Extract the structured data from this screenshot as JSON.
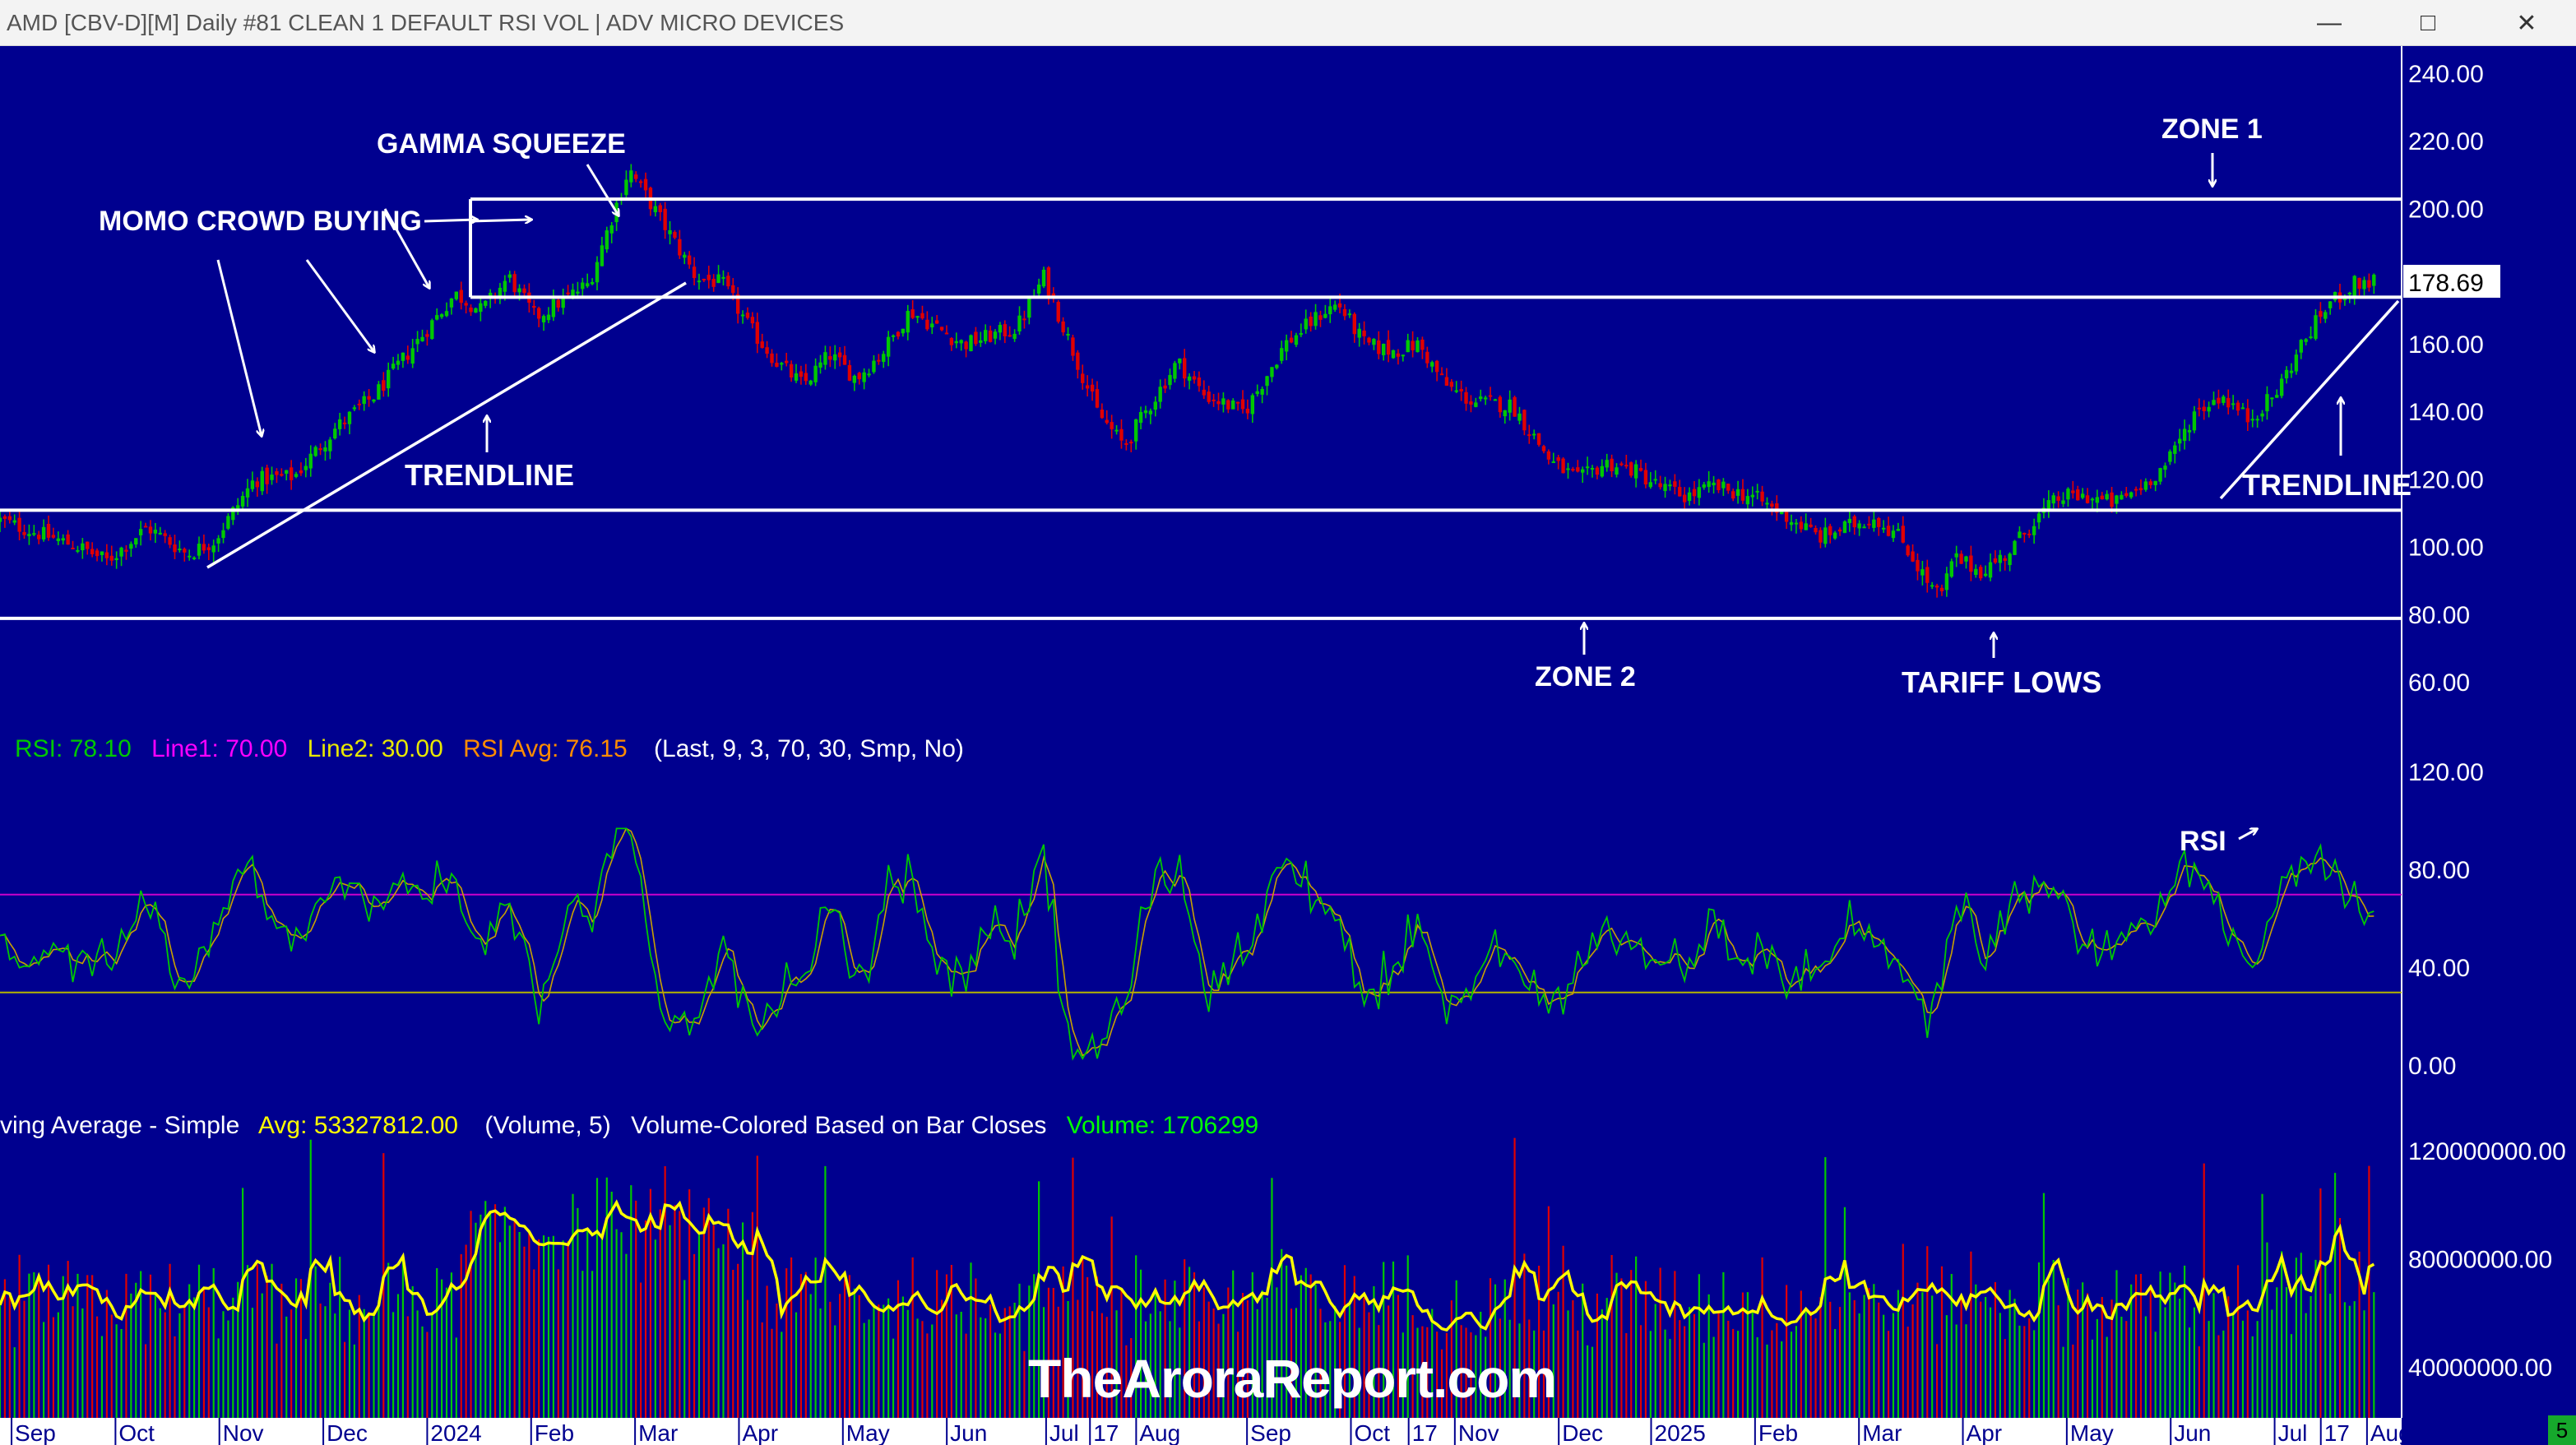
{
  "window": {
    "title": "AMD [CBV-D][M]  Daily #81 CLEAN  1 DEFAULT RSI VOL | ADV MICRO DEVICES",
    "minimize_icon": "minimize-icon",
    "maximize_icon": "maximize-icon",
    "close_icon": "close-icon"
  },
  "watermark": "TheAroraReport.com",
  "badge": "5",
  "chart_data": [
    {
      "type": "candlestick",
      "ylim": [
        55,
        245
      ],
      "y_ticks": [
        "240.00",
        "220.00",
        "200.00",
        "180.00",
        "160.00",
        "140.00",
        "120.00",
        "100.00",
        "80.00",
        "60.00"
      ],
      "last_price": "178.69",
      "up_color": "#00c800",
      "down_color": "#e00000",
      "close_path": [
        {
          "t": 0,
          "v": 108
        },
        {
          "t": 3,
          "v": 100
        },
        {
          "t": 4,
          "v": 96
        },
        {
          "t": 5.5,
          "v": 106
        },
        {
          "t": 7,
          "v": 98
        },
        {
          "t": 8,
          "v": 102
        },
        {
          "t": 9.5,
          "v": 120
        },
        {
          "t": 11,
          "v": 121
        },
        {
          "t": 12.5,
          "v": 135
        },
        {
          "t": 14,
          "v": 145
        },
        {
          "t": 16,
          "v": 165
        },
        {
          "t": 17,
          "v": 175
        },
        {
          "t": 18,
          "v": 170
        },
        {
          "t": 19,
          "v": 180
        },
        {
          "t": 20,
          "v": 168
        },
        {
          "t": 22,
          "v": 178
        },
        {
          "t": 23.5,
          "v": 212
        },
        {
          "t": 25,
          "v": 193
        },
        {
          "t": 26,
          "v": 180
        },
        {
          "t": 27,
          "v": 178
        },
        {
          "t": 28,
          "v": 165
        },
        {
          "t": 29,
          "v": 155
        },
        {
          "t": 30,
          "v": 148
        },
        {
          "t": 31,
          "v": 157
        },
        {
          "t": 32,
          "v": 150
        },
        {
          "t": 33,
          "v": 158
        },
        {
          "t": 34,
          "v": 170
        },
        {
          "t": 36,
          "v": 160
        },
        {
          "t": 38,
          "v": 165
        },
        {
          "t": 39,
          "v": 180
        },
        {
          "t": 40,
          "v": 160
        },
        {
          "t": 41,
          "v": 140
        },
        {
          "t": 42,
          "v": 130
        },
        {
          "t": 44,
          "v": 155
        },
        {
          "t": 45,
          "v": 145
        },
        {
          "t": 46.5,
          "v": 140
        },
        {
          "t": 48,
          "v": 160
        },
        {
          "t": 49.5,
          "v": 170
        },
        {
          "t": 50,
          "v": 172
        },
        {
          "t": 51,
          "v": 160
        },
        {
          "t": 52,
          "v": 158
        },
        {
          "t": 53,
          "v": 160
        },
        {
          "t": 54,
          "v": 148
        },
        {
          "t": 55,
          "v": 143
        },
        {
          "t": 56.5,
          "v": 142
        },
        {
          "t": 58,
          "v": 125
        },
        {
          "t": 59,
          "v": 120
        },
        {
          "t": 60,
          "v": 125
        },
        {
          "t": 61,
          "v": 123
        },
        {
          "t": 62,
          "v": 118
        },
        {
          "t": 63,
          "v": 115
        },
        {
          "t": 64,
          "v": 118
        },
        {
          "t": 65.5,
          "v": 115
        },
        {
          "t": 67,
          "v": 108
        },
        {
          "t": 68,
          "v": 103
        },
        {
          "t": 69,
          "v": 106
        },
        {
          "t": 70,
          "v": 109
        },
        {
          "t": 71,
          "v": 103
        },
        {
          "t": 72,
          "v": 90
        },
        {
          "t": 72.5,
          "v": 85
        },
        {
          "t": 73,
          "v": 97
        },
        {
          "t": 74,
          "v": 93
        },
        {
          "t": 75,
          "v": 98
        },
        {
          "t": 76,
          "v": 108
        },
        {
          "t": 77,
          "v": 115
        },
        {
          "t": 78,
          "v": 115
        },
        {
          "t": 79,
          "v": 113
        },
        {
          "t": 80,
          "v": 118
        },
        {
          "t": 81,
          "v": 125
        },
        {
          "t": 82,
          "v": 140
        },
        {
          "t": 83,
          "v": 145
        },
        {
          "t": 84,
          "v": 138
        },
        {
          "t": 85,
          "v": 145
        },
        {
          "t": 86,
          "v": 160
        },
        {
          "t": 87,
          "v": 172
        },
        {
          "t": 88,
          "v": 178
        },
        {
          "t": 88.7,
          "v": 178.69
        }
      ]
    },
    {
      "type": "line",
      "ylim": [
        0,
        130
      ],
      "y_ticks": [
        "120.00",
        "80.00",
        "40.00",
        "0.00"
      ],
      "series": [
        {
          "name": "RSI",
          "value": "78.10",
          "color": "#00c800"
        },
        {
          "name": "Line1",
          "value": "70.00",
          "color": "#cc00cc"
        },
        {
          "name": "Line2",
          "value": "30.00",
          "color": "#c8c800"
        },
        {
          "name": "RSI Avg",
          "value": "76.15",
          "color": "#ff8c00"
        }
      ],
      "params": "(Last, 9, 3, 70, 30, Smp, No)",
      "line1_level": 70,
      "line2_level": 30
    },
    {
      "type": "bar",
      "ylim": [
        20000000,
        127000000
      ],
      "y_ticks": [
        "120000000.00",
        "80000000.00",
        "40000000.00"
      ],
      "label_prefix": "ving Average - Simple",
      "avg_label": "Avg: 53327812.00",
      "params": "(Volume, 5)",
      "coloring_note": "Volume-Colored Based on Bar Closes",
      "volume_label": "Volume: 1706299",
      "avg_color": "#ffff00"
    }
  ],
  "x_axis": {
    "labels": [
      "Sep",
      "Oct",
      "Nov",
      "Dec",
      "2024",
      "Feb",
      "Mar",
      "Apr",
      "May",
      "Jun",
      "Jul",
      "17",
      "Aug",
      "Sep",
      "Oct",
      "17",
      "Nov",
      "Dec",
      "2025",
      "Feb",
      "Mar",
      "Apr",
      "May",
      "Jun",
      "Jul",
      "17",
      "Aug"
    ],
    "label_t": [
      0.5,
      5,
      9.5,
      14,
      18.5,
      23,
      27.5,
      32,
      36.5,
      41,
      45.3,
      47.2,
      49.2,
      54,
      58.5,
      61,
      63,
      67.5,
      71.5,
      76,
      80.5,
      85,
      89.5,
      94,
      98.5,
      100.5,
      102.5
    ]
  },
  "annotations": {
    "momo": "MOMO CROWD BUYING",
    "gamma": "GAMMA SQUEEZE",
    "trendline_left": "TRENDLINE",
    "trendline_right": "TRENDLINE",
    "zone1": "ZONE 1",
    "zone2": "ZONE 2",
    "tariff": "TARIFF LOWS",
    "rsi": "RSI"
  },
  "levels": {
    "zone1_top": 203,
    "zone1_bottom": 174,
    "middle": 111,
    "zone2": 79
  }
}
